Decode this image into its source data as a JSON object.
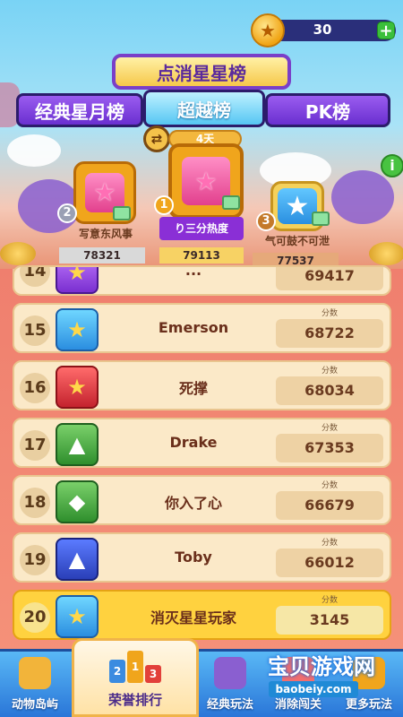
{
  "header": {
    "coin_count": "30",
    "add_label": "+",
    "title": "点消星星榜"
  },
  "tabs": [
    {
      "label": "经典星月榜",
      "active": false
    },
    {
      "label": "超越榜",
      "active": true
    },
    {
      "label": "PK榜",
      "active": false
    }
  ],
  "period": {
    "days_label": "4天"
  },
  "podium": [
    {
      "rank": "2",
      "name": "写意东风事",
      "score": "78321"
    },
    {
      "rank": "1",
      "name": "り三分热度",
      "score": "79113"
    },
    {
      "rank": "3",
      "name": "气可鼓不可泄",
      "score": "77537"
    }
  ],
  "list": {
    "score_label": "分数",
    "rows": [
      {
        "rank": "14",
        "name": "...",
        "score": "69417",
        "avatar": "star-icon",
        "mine": false
      },
      {
        "rank": "15",
        "name": "Emerson",
        "score": "68722",
        "avatar": "star-icon",
        "mine": false
      },
      {
        "rank": "16",
        "name": "死撑",
        "score": "68034",
        "avatar": "star-icon",
        "mine": false
      },
      {
        "rank": "17",
        "name": "Drake",
        "score": "67353",
        "avatar": "rocket-icon",
        "mine": false
      },
      {
        "rank": "18",
        "name": "你入了心",
        "score": "66679",
        "avatar": "gem-icon",
        "mine": false
      },
      {
        "rank": "19",
        "name": "Toby",
        "score": "66012",
        "avatar": "rocket-icon",
        "mine": false
      },
      {
        "rank": "20",
        "name": "消灭星星玩家",
        "score": "3145",
        "avatar": "star-icon",
        "mine": true
      }
    ]
  },
  "bottom_nav": [
    {
      "label": "动物岛屿",
      "icon": "hammer-icon",
      "active": false
    },
    {
      "label": "荣誉排行",
      "icon": "podium-icon",
      "active": true
    },
    {
      "label": "经典玩法",
      "icon": "house-icon",
      "active": false
    },
    {
      "label": "消除闯关",
      "icon": "level-icon",
      "active": false
    },
    {
      "label": "更多玩法",
      "icon": "trophy-icon",
      "active": false
    }
  ],
  "podium_mini": [
    "2",
    "1",
    "3"
  ],
  "watermark": {
    "text": "宝贝游戏网",
    "sub": "baobeiy.com"
  },
  "colors": {
    "tab_active": "#56c6f3",
    "tab_inactive": "#6a2fd0",
    "row_bg": "#fbe9c8",
    "row_mine_bg": "#ffd23f",
    "nav_bg": "#2a76d8"
  }
}
